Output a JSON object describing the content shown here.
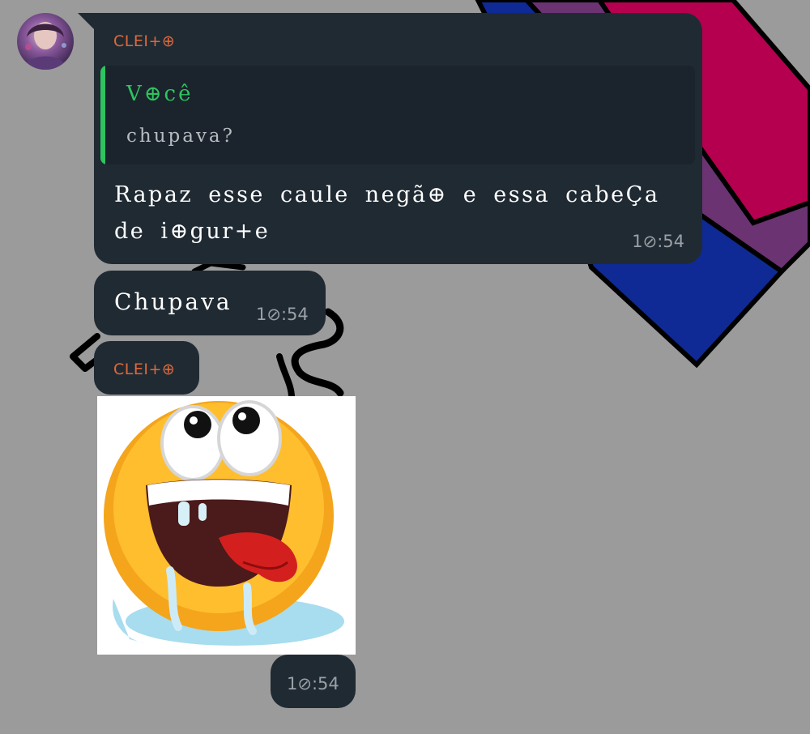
{
  "chat": {
    "messages": [
      {
        "sender": "CLEI+⊕",
        "reply_to": {
          "author": "V⊕cê",
          "text": "chupava?"
        },
        "text": "Rapaz esse caule negã⊕ e essa cabeÇa de i⊕gur+e",
        "time": "1⊘:54"
      },
      {
        "text": "Chupava",
        "time": "1⊘:54"
      },
      {
        "sender": "CLEI+⊕",
        "sticker": "drooling-emoji-sticker",
        "time": "1⊘:54"
      }
    ]
  },
  "colors": {
    "wallpaper": "#9b9b9b",
    "bubble": "#202a33",
    "quote_background": "#1b242c",
    "quote_accent": "#2ec45f",
    "sender_name": "#e0693a",
    "timestamp": "#9aa0a6",
    "flag_pink": "#b5004f",
    "flag_purple": "#6b3372",
    "flag_blue": "#0f2a94"
  }
}
